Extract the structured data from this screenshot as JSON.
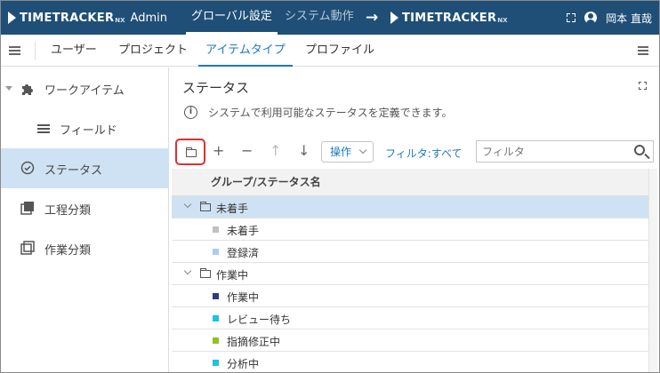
{
  "app": {
    "logo_text": "TIMETRACKER",
    "logo_suffix": "NX",
    "admin_label": "Admin"
  },
  "top_tabs": [
    {
      "label": "グローバル設定",
      "active": true
    },
    {
      "label": "システム動作",
      "active": false
    }
  ],
  "user": {
    "name": "岡本 直哉"
  },
  "nav_tabs": [
    {
      "label": "ユーザー"
    },
    {
      "label": "プロジェクト"
    },
    {
      "label": "アイテムタイプ"
    },
    {
      "label": "プロファイル"
    }
  ],
  "sidebar": {
    "items": [
      {
        "label": "ワークアイテム",
        "icon": "puzzle-icon"
      },
      {
        "label": "フィールド",
        "icon": "lines-icon"
      },
      {
        "label": "ステータス",
        "icon": "check-circle-icon"
      },
      {
        "label": "工程分類",
        "icon": "stack-icon"
      },
      {
        "label": "作業分類",
        "icon": "squares-icon"
      }
    ]
  },
  "section": {
    "title": "ステータス",
    "description": "システムで利用可能なステータスを定義できます。"
  },
  "toolbar": {
    "add": "+",
    "remove": "−",
    "up": "↑",
    "down": "↓",
    "operations_label": "操作",
    "filter_all_label": "フィルタ:すべて",
    "filter_placeholder": "フィルタ"
  },
  "grid": {
    "header": "グループ/ステータス名",
    "rows": [
      {
        "type": "group",
        "label": "未着手"
      },
      {
        "type": "status",
        "label": "未着手",
        "color": "#c0c0c0"
      },
      {
        "type": "status",
        "label": "登録済",
        "color": "#a9cdf5"
      },
      {
        "type": "group",
        "label": "作業中"
      },
      {
        "type": "status",
        "label": "作業中",
        "color": "#2a3b8f"
      },
      {
        "type": "status",
        "label": "レビュー待ち",
        "color": "#1ec0ea"
      },
      {
        "type": "status",
        "label": "指摘修正中",
        "color": "#8fc31f"
      },
      {
        "type": "status",
        "label": "分析中",
        "color": "#1ec0ea"
      }
    ]
  },
  "colors": {
    "header_bg": "#1f4f77",
    "accent": "#1b78c2",
    "selection": "#cfe2f4",
    "highlight_border": "#e03030"
  }
}
